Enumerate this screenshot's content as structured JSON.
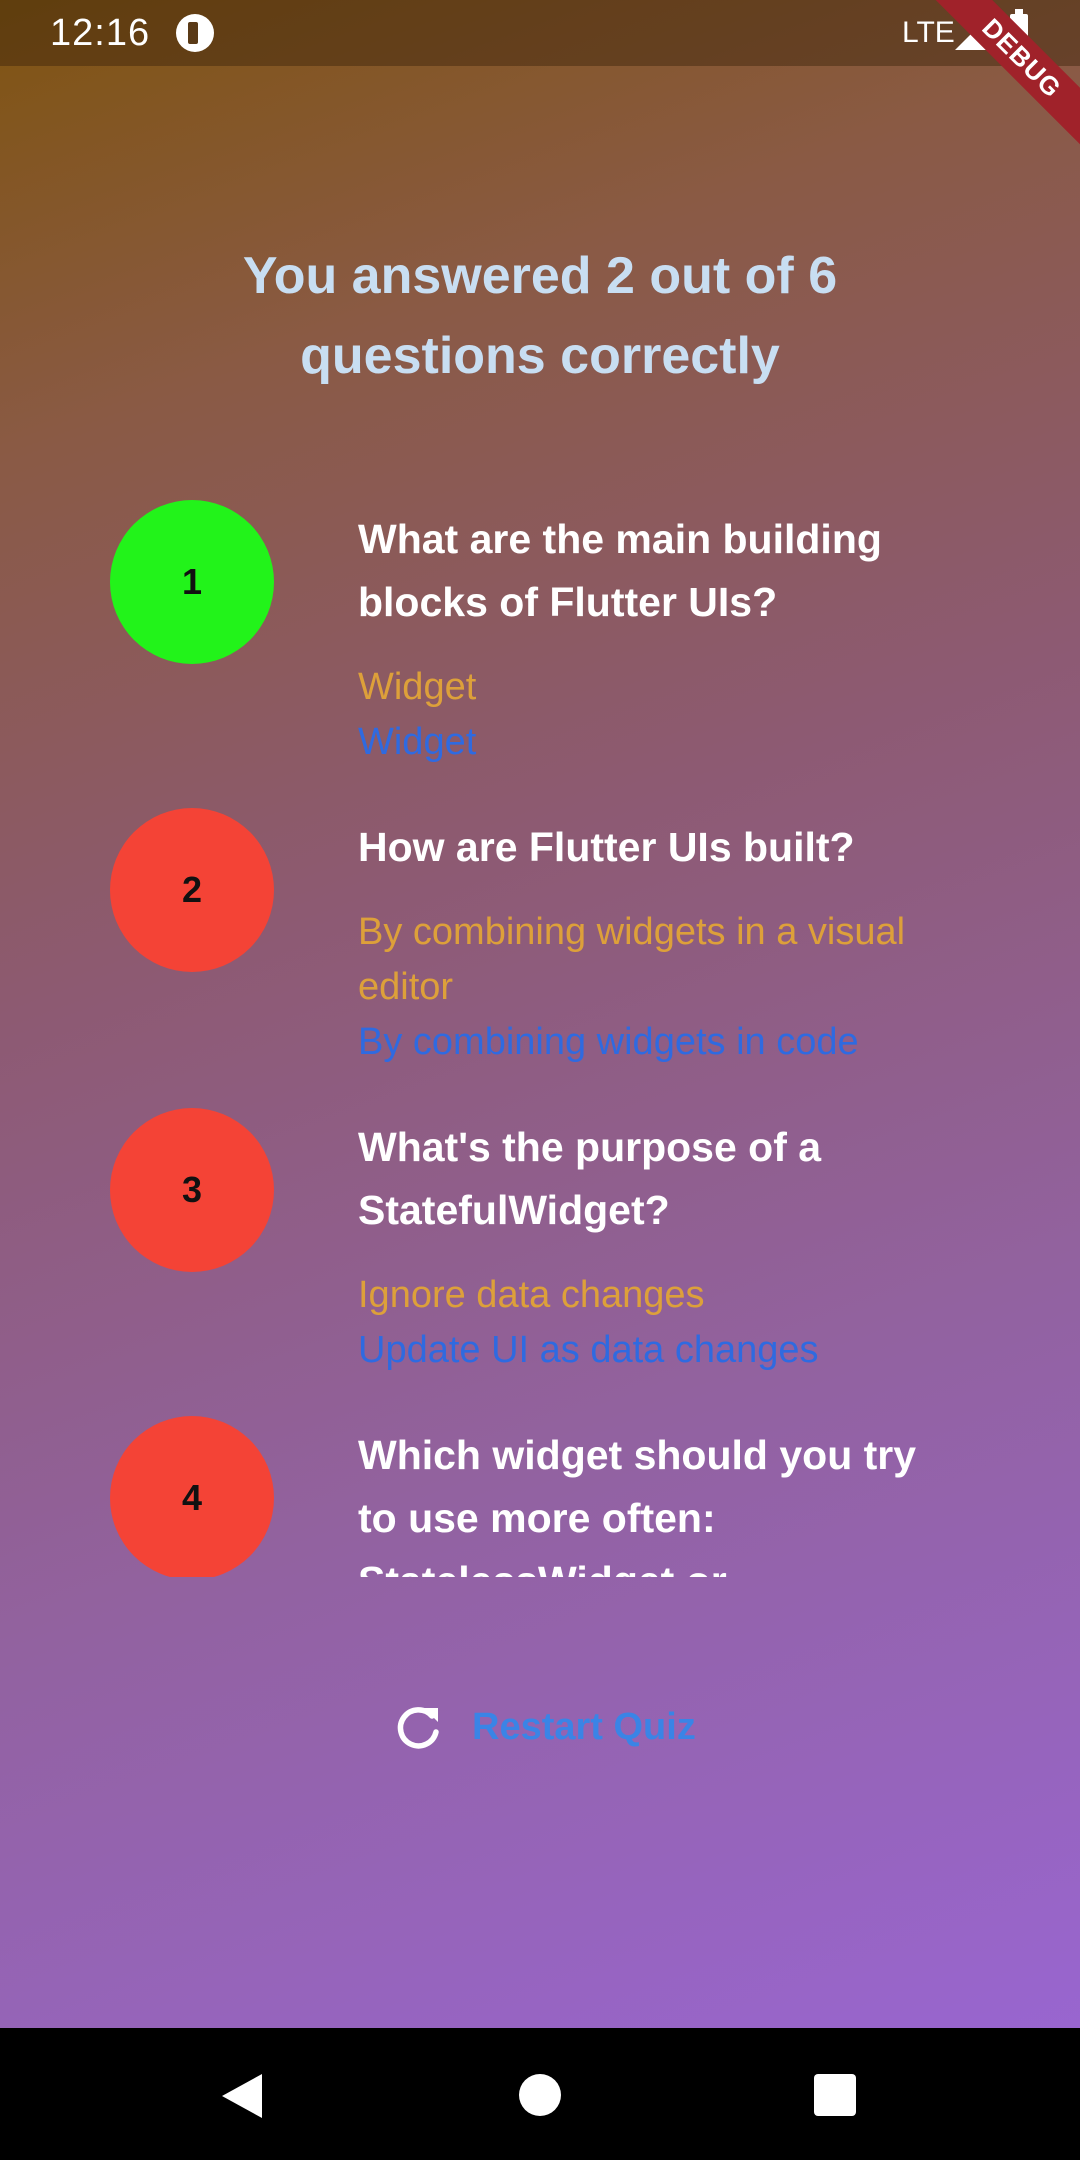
{
  "status_bar": {
    "time": "12:16",
    "network": "LTE",
    "app_icon": "app-notification-icon",
    "signal_icon": "signal-icon",
    "battery_icon": "battery-icon"
  },
  "debug_banner": "DEBUG",
  "result": {
    "title": "You answered 2 out of 6 questions correctly"
  },
  "colors": {
    "correct": "#22f31a",
    "incorrect": "#f44336",
    "user_answer": "#dda03a",
    "correct_answer": "#2f6ae0",
    "title": "#c8def2"
  },
  "summary": [
    {
      "index": "1",
      "is_correct": true,
      "question": "What are the main building blocks of Flutter UIs?",
      "user_answer": "Widget",
      "correct_answer": "Widget"
    },
    {
      "index": "2",
      "is_correct": false,
      "question": "How are Flutter UIs built?",
      "user_answer": "By combining widgets in a visual editor",
      "correct_answer": "By combining widgets in code"
    },
    {
      "index": "3",
      "is_correct": false,
      "question": "What's the purpose of a StatefulWidget?",
      "user_answer": "Ignore data changes",
      "correct_answer": "Update UI as data changes"
    },
    {
      "index": "4",
      "is_correct": false,
      "question": "Which widget should you try to use more often: StatelessWidget or"
    }
  ],
  "restart": {
    "icon": "refresh-icon",
    "label": "Restart Quiz"
  },
  "nav_bar": {
    "back_icon": "back-icon",
    "home_icon": "home-icon",
    "recents_icon": "recents-icon"
  }
}
